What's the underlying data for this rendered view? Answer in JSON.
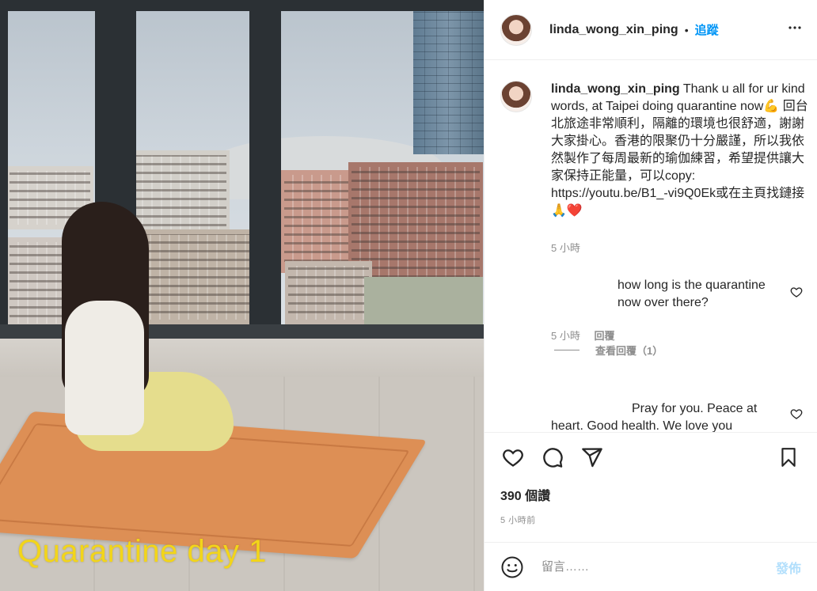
{
  "header": {
    "username": "linda_wong_xin_ping",
    "separator": "•",
    "follow_label": "追蹤",
    "more_icon": "more-icon"
  },
  "photo": {
    "caption_overlay": "Quarantine day 1"
  },
  "caption": {
    "username": "linda_wong_xin_ping",
    "text": "Thank u all for ur kind words, at Taipei doing quarantine now💪 回台北旅途非常順利，隔離的環境也很舒適，謝謝大家掛心。香港的限聚仍十分嚴謹，所以我依然製作了每周最新的瑜伽練習，希望提供讓大家保持正能量，可以copy: https://youtu.be/B1_-vi9Q0Ek或在主頁找鏈接🙏❤️",
    "time": "5 小時"
  },
  "comments": [
    {
      "text": "how long is the quarantine now over there?",
      "time": "5 小時",
      "reply_label": "回覆",
      "view_replies": "查看回覆（1）"
    },
    {
      "text": "Pray for you. Peace at heart. Good health. We love you"
    }
  ],
  "actions": {
    "like_icon": "heart-icon",
    "comment_icon": "comment-icon",
    "share_icon": "share-icon",
    "save_icon": "bookmark-icon"
  },
  "stats": {
    "likes": "390 個讚",
    "posted": "5 小時前"
  },
  "comment_box": {
    "placeholder": "留言……",
    "post_label": "發佈"
  },
  "colors": {
    "link_blue": "#0095f6",
    "post_disabled": "#b2dffc",
    "caption_yellow": "#f2d51a"
  }
}
